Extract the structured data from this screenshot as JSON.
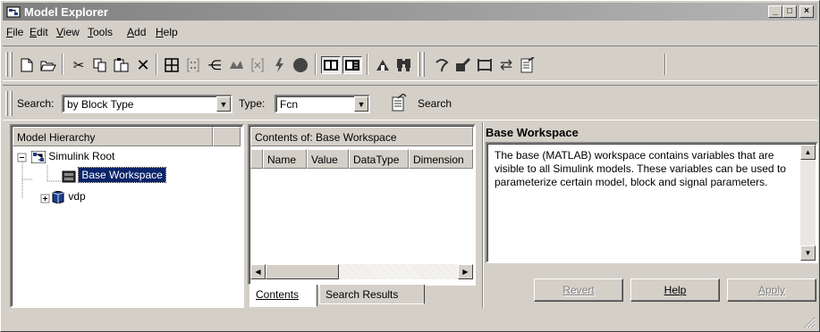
{
  "window": {
    "title": "Model Explorer",
    "minimize": "_",
    "maximize": "□",
    "close": "×"
  },
  "menu": [
    "File",
    "Edit",
    "View",
    "Tools",
    "Add",
    "Help"
  ],
  "menu_underline": [
    "F",
    "E",
    "V",
    "T",
    "A",
    "H"
  ],
  "toolbar": {
    "icons": [
      "new-icon",
      "open-icon",
      "cut-icon",
      "copy-icon",
      "paste-icon",
      "delete-icon",
      "grid-icon",
      "matrix-icon",
      "signal-icon",
      "block-icon",
      "bus-icon",
      "flash-icon",
      "record-icon",
      "view-list-icon",
      "view-detail-icon",
      "find-icon",
      "lookup-icon",
      "help-icon",
      "edit-icon",
      "brackets-icon",
      "swap-icon",
      "notes-icon"
    ]
  },
  "search": {
    "search_label": "Search:",
    "search_by": "by Block Type",
    "type_label": "Type:",
    "type_value": "Fcn",
    "search_button": "Search"
  },
  "hierarchy": {
    "header": "Model Hierarchy",
    "root": "Simulink Root",
    "items": [
      "Base Workspace",
      "vdp"
    ],
    "selected": "Base Workspace"
  },
  "contents": {
    "header": "Contents of:  Base Workspace",
    "columns": [
      "Name",
      "Value",
      "DataType",
      "Dimension"
    ],
    "tabs": [
      "Contents",
      "Search Results"
    ]
  },
  "dialog": {
    "title": "Base Workspace",
    "text": "The base (MATLAB) workspace contains variables that are visible to all Simulink models. These variables can be used to parameterize certain model, block and signal parameters.",
    "buttons": [
      "Revert",
      "Help",
      "Apply"
    ]
  }
}
